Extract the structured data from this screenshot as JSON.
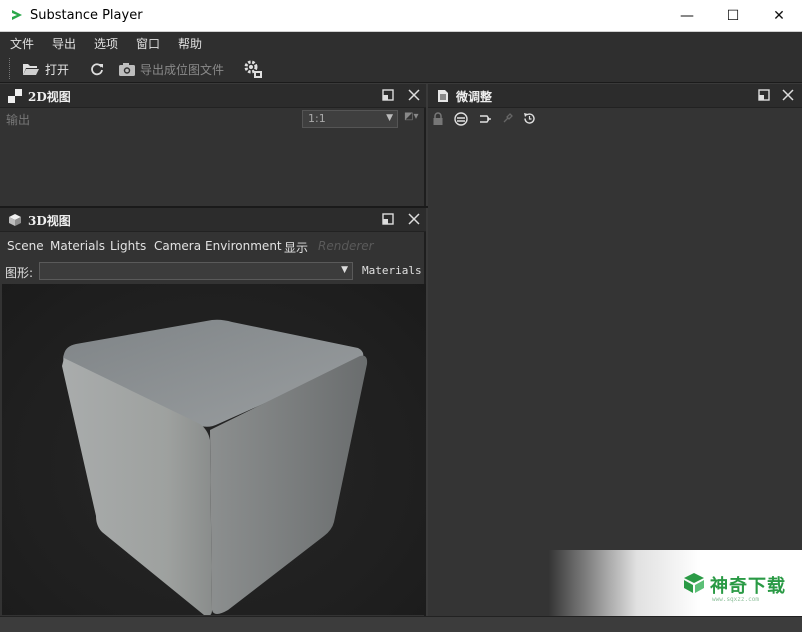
{
  "window": {
    "title": "Substance Player",
    "minimize": "—",
    "maximize": "☐",
    "close": "✕"
  },
  "menu": [
    "文件",
    "导出",
    "选项",
    "窗口",
    "帮助"
  ],
  "toolbar": {
    "open_label": "打开",
    "export_label": "导出成位图文件"
  },
  "panel2d": {
    "title": "2D视图",
    "output_label": "输出",
    "zoom_value": "1:1"
  },
  "panel3d": {
    "title": "3D视图",
    "tabs": [
      "Scene",
      "Materials",
      "Lights",
      "Camera",
      "Environment",
      "显示",
      "Renderer"
    ],
    "shape_label": "图形:",
    "shape_value": "",
    "materials_label": "Materials"
  },
  "paneltweak": {
    "title": "微调整"
  },
  "watermark": {
    "text": "神奇下载",
    "sub": "www.sqxzz.com"
  },
  "colors": {
    "background": "#3a3a3a",
    "panel": "#333333",
    "header": "#2c2c2c",
    "accent_green": "#2a9a45"
  }
}
